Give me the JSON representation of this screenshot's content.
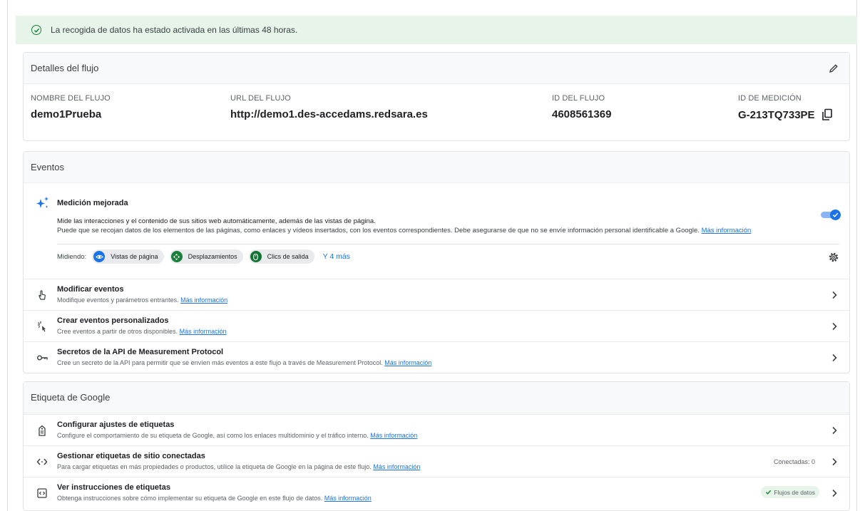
{
  "banner": {
    "text": "La recogida de datos ha estado activada en las últimas 48 horas."
  },
  "details": {
    "title": "Detalles del flujo",
    "fields": [
      {
        "label": "NOMBRE DEL FLUJO",
        "value": "demo1Prueba"
      },
      {
        "label": "URL DEL FLUJO",
        "value": "http://demo1.des-accedams.redsara.es"
      },
      {
        "label": "ID DEL FLUJO",
        "value": "4608561369"
      },
      {
        "label": "ID DE MEDICIÓN",
        "value": "G-213TQ733PE"
      }
    ]
  },
  "events": {
    "title": "Eventos",
    "enhanced": {
      "title": "Medición mejorada",
      "desc1": "Mide las interacciones y el contenido de sus sitios web automáticamente, además de las vistas de página.",
      "desc2": "Puede que se recojan datos de los elementos de las páginas, como enlaces y vídeos insertados, con los eventos correspondientes. Debe asegurarse de que no se envíe información personal identificable a Google.",
      "more_link": "Más información",
      "measuring_label": "Midiendo:",
      "chips": [
        "Vistas de página",
        "Desplazamientos",
        "Clics de salida"
      ],
      "more_chips": "Y 4 más",
      "enabled": true
    },
    "rows": [
      {
        "title": "Modificar eventos",
        "desc": "Modifique eventos y parámetros entrantes.",
        "link": "Más información"
      },
      {
        "title": "Crear eventos personalizados",
        "desc": "Cree eventos a partir de otros disponibles.",
        "link": "Más información"
      },
      {
        "title": "Secretos de la API de Measurement Protocol",
        "desc": "Cree un secreto de la API para permitir que se envíen más eventos a este flujo a través de Measurement Protocol.",
        "link": "Más información"
      }
    ]
  },
  "gtag": {
    "title": "Etiqueta de Google",
    "rows": [
      {
        "title": "Configurar ajustes de etiquetas",
        "desc": "Configure el comportamiento de su etiqueta de Google, así como los enlaces multidominio y el tráfico interno.",
        "link": "Más información"
      },
      {
        "title": "Gestionar etiquetas de sitio conectadas",
        "desc": "Para cargar etiquetas en más propiedades o productos, utilice la etiqueta de Google en la página de este flujo.",
        "link": "Más información",
        "right": "Conectadas: 0"
      },
      {
        "title": "Ver instrucciones de etiquetas",
        "desc": "Obtenga instrucciones sobre cómo implementar su etiqueta de Google en este flujo de datos.",
        "link": "Más información",
        "badge": "Flujos de datos"
      }
    ]
  },
  "colors": {
    "accent": "#1a73e8",
    "success": "#188038",
    "banner_bg": "#e6f4ea"
  }
}
